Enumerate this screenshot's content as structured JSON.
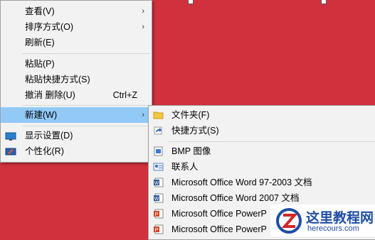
{
  "context_menu": {
    "items": [
      {
        "label": "查看(V)"
      },
      {
        "label": "排序方式(O)"
      },
      {
        "label": "刷新(E)"
      },
      {
        "label": "粘贴(P)"
      },
      {
        "label": "粘贴快捷方式(S)"
      },
      {
        "label": "撤消 删除(U)",
        "shortcut": "Ctrl+Z"
      },
      {
        "label": "新建(W)"
      },
      {
        "label": "显示设置(D)",
        "icon": "display-settings-icon"
      },
      {
        "label": "个性化(R)",
        "icon": "personalize-icon"
      }
    ]
  },
  "new_submenu": {
    "items": [
      {
        "label": "文件夹(F)",
        "icon": "folder-icon"
      },
      {
        "label": "快捷方式(S)",
        "icon": "shortcut-icon"
      },
      {
        "label": "BMP 图像",
        "icon": "bmp-image-icon"
      },
      {
        "label": "联系人",
        "icon": "contact-icon"
      },
      {
        "label": "Microsoft Office Word 97-2003 文档",
        "icon": "word-doc-icon"
      },
      {
        "label": "Microsoft Office Word 2007 文档",
        "icon": "word-docx-icon"
      },
      {
        "label": "Microsoft Office PowerP",
        "icon": "powerpoint-icon"
      },
      {
        "label": "Microsoft Office PowerP",
        "icon": "powerpoint-icon"
      }
    ]
  },
  "watermark": {
    "title": "这里教程网",
    "url": "herecours.com"
  },
  "colors": {
    "desktop": "#d1313c",
    "menu_bg": "#f2f2f2",
    "highlight": "#91c9f7",
    "logo_blue": "#1f4ea3",
    "logo_red": "#d4262a"
  }
}
